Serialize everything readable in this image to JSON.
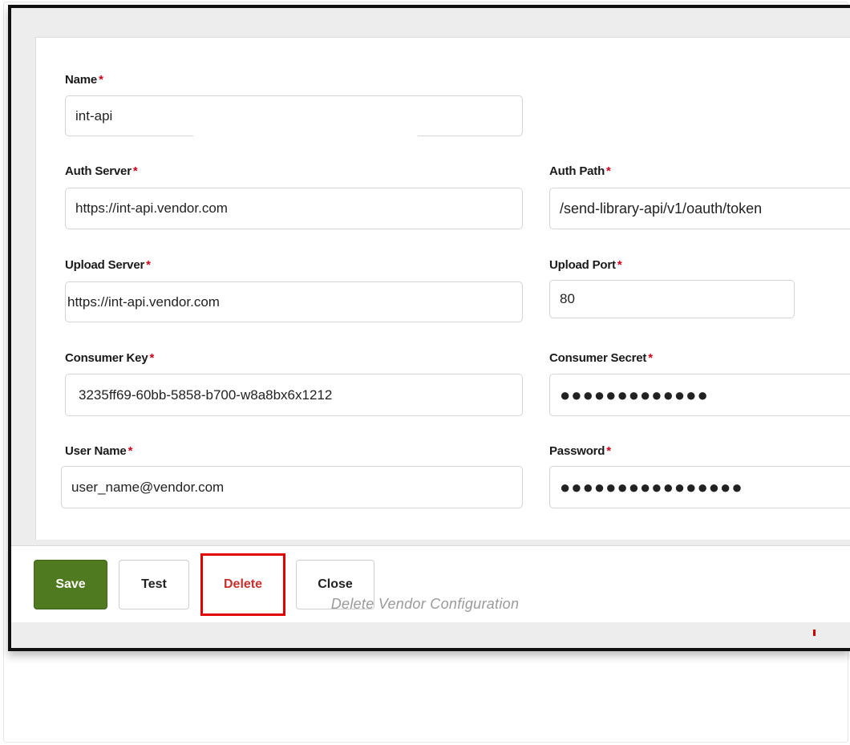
{
  "form": {
    "name": {
      "label": "Name",
      "required": "*",
      "value": "int-api"
    },
    "auth_server": {
      "label": "Auth Server",
      "required": "*",
      "value": "https://int-api.vendor.com"
    },
    "auth_path": {
      "label": "Auth Path",
      "required": "*",
      "value": "/send-library-api/v1/oauth/token"
    },
    "upload_server": {
      "label": "Upload Server",
      "required": "*",
      "value": "https://int-api.vendor.com"
    },
    "upload_port": {
      "label": "Upload Port",
      "required": "*",
      "value": "80"
    },
    "consumer_key": {
      "label": "Consumer Key",
      "required": "*",
      "value": "3235ff69-60bb-5858-b700-w8a8bx6x1212"
    },
    "consumer_secret": {
      "label": "Consumer Secret",
      "required": "*",
      "value": "●●●●●●●●●●●●●"
    },
    "user_name": {
      "label": "User Name",
      "required": "*",
      "value": "user_name@vendor.com"
    },
    "password": {
      "label": "Password",
      "required": "*",
      "value": "●●●●●●●●●●●●●●●●"
    }
  },
  "footer": {
    "save_label": "Save",
    "test_label": "Test",
    "delete_label": "Delete",
    "close_label": "Close"
  },
  "caption": "Delete Vendor Configuration",
  "colors": {
    "save_button": "#4f7a1f",
    "delete_text": "#c9302c",
    "required_star": "#d0021b",
    "highlight_box": "#e00000",
    "caption_text": "#9a9a9a"
  }
}
